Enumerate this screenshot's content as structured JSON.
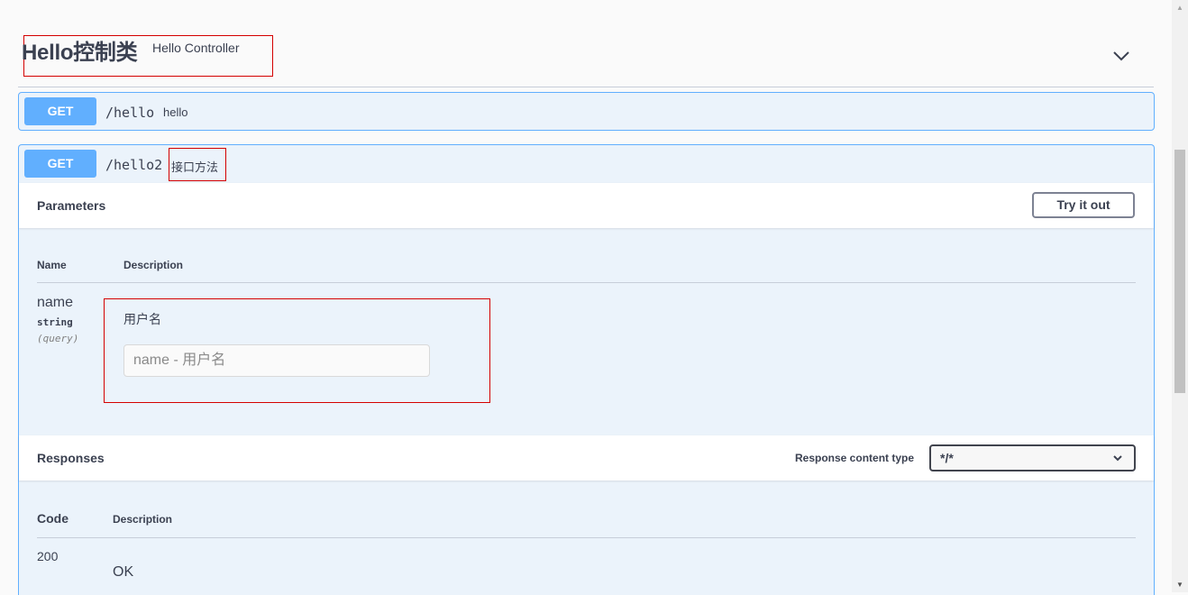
{
  "tag": {
    "title": "Hello控制类",
    "description": "Hello Controller",
    "toggle_icon": "chevron-down-icon"
  },
  "operations": [
    {
      "method": "GET",
      "path": "/hello",
      "summary": "hello"
    },
    {
      "method": "GET",
      "path": "/hello2",
      "summary": "接口方法"
    }
  ],
  "parameters": {
    "title": "Parameters",
    "try_label": "Try it out",
    "col_name": "Name",
    "col_description": "Description",
    "items": [
      {
        "name": "name",
        "type": "string",
        "in": "(query)",
        "description": "用户名",
        "placeholder": "name - 用户名"
      }
    ]
  },
  "responses": {
    "title": "Responses",
    "content_type_label": "Response content type",
    "content_type_value": "*/*",
    "col_code": "Code",
    "col_description": "Description",
    "items": [
      {
        "code": "200",
        "description": "OK"
      }
    ]
  },
  "colors": {
    "get_method": "#61affe",
    "opblock_bg": "#ebf3fb",
    "highlight_border": "#d40000"
  }
}
